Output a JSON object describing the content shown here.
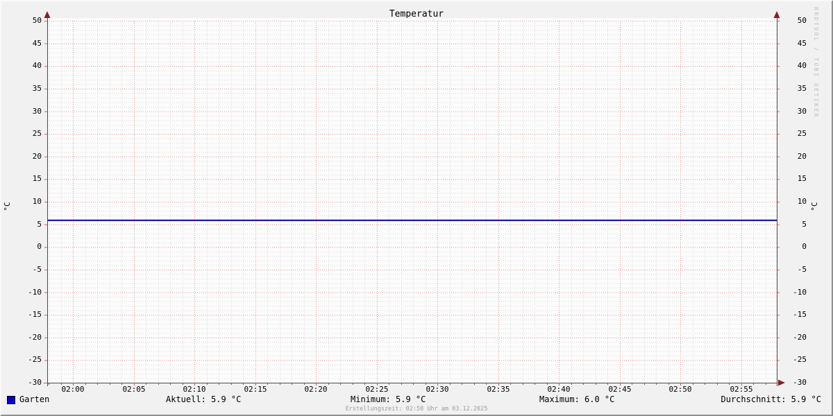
{
  "title": "Temperatur",
  "watermark": "RRDTOOL / TOBI OETIKER",
  "y_axis_label_left": "°C",
  "y_axis_label_right": "°C",
  "footer": "Erstellungszeit: 02:58 Uhr am 03.12.2025",
  "legend": {
    "series_name": "Garten",
    "series_color": "#0000cc",
    "aktuell": "Aktuell: 5.9 °C",
    "minimum": "Minimum: 5.9 °C",
    "maximum": "Maximum: 6.0 °C",
    "durchschnitt": "Durchschnitt: 5.9 °C"
  },
  "chart_data": {
    "type": "line",
    "title": "Temperatur",
    "ylabel": "°C",
    "ylim": [
      -30,
      50
    ],
    "y_tick_step": 5,
    "y_minor_step": 1,
    "x_tick_labels": [
      "02:00",
      "02:05",
      "02:10",
      "02:15",
      "02:20",
      "02:25",
      "02:30",
      "02:35",
      "02:40",
      "02:45",
      "02:50",
      "02:55"
    ],
    "x_minutes_per_major": 5,
    "grid": true,
    "legend_position": "bottom",
    "series": [
      {
        "name": "Garten",
        "color": "#000099",
        "legend_color": "#0000cc",
        "value": 5.9,
        "unit": "°C",
        "stats": {
          "current": 5.9,
          "min": 5.9,
          "max": 6.0,
          "avg": 5.9
        }
      }
    ],
    "colors": {
      "back": "#f1f1f1",
      "canvas": "#fcfcfc",
      "major_grid": "#ee9595",
      "minor_grid": "#d9d9d9",
      "axis": "#4a4a4a",
      "arrow": "#8b1e1e"
    }
  }
}
